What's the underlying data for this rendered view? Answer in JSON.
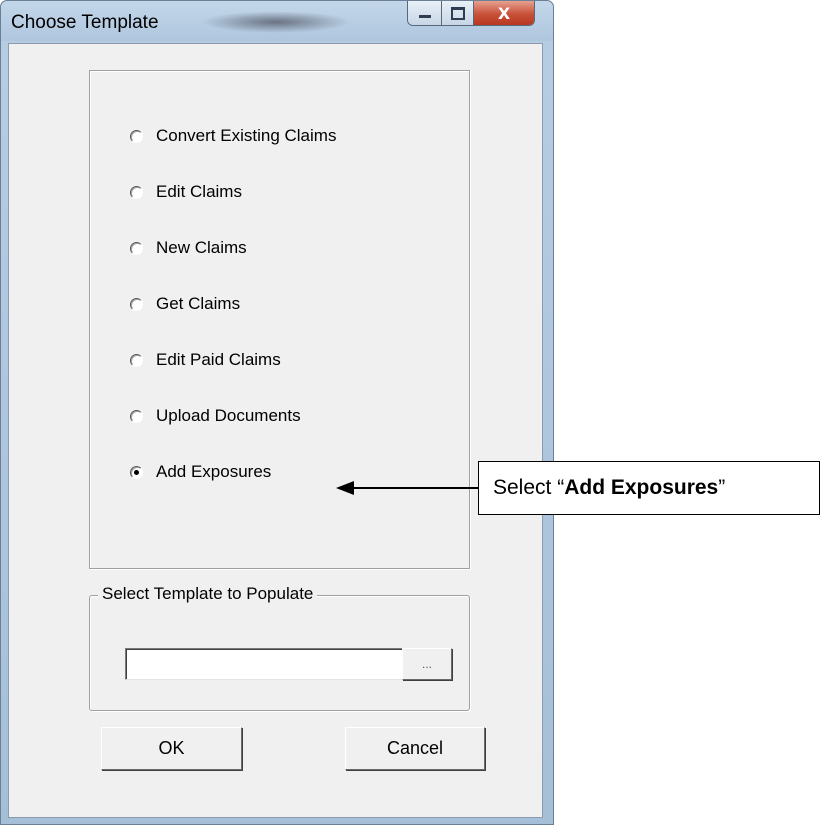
{
  "window": {
    "title": "Choose Template",
    "close_glyph": "X",
    "accent_close_color": "#c8513a"
  },
  "options": [
    {
      "label": "Convert Existing Claims",
      "checked": false
    },
    {
      "label": "Edit Claims",
      "checked": false
    },
    {
      "label": "New Claims",
      "checked": false
    },
    {
      "label": "Get Claims",
      "checked": false
    },
    {
      "label": "Edit Paid Claims",
      "checked": false
    },
    {
      "label": "Upload Documents",
      "checked": false
    },
    {
      "label": "Add Exposures",
      "checked": true
    }
  ],
  "template_group": {
    "legend": "Select Template to Populate",
    "path_value": "",
    "browse_label": "..."
  },
  "buttons": {
    "ok": "OK",
    "cancel": "Cancel"
  },
  "callout": {
    "prefix": "Select “",
    "emphasis": "Add Exposures",
    "suffix": "”"
  }
}
